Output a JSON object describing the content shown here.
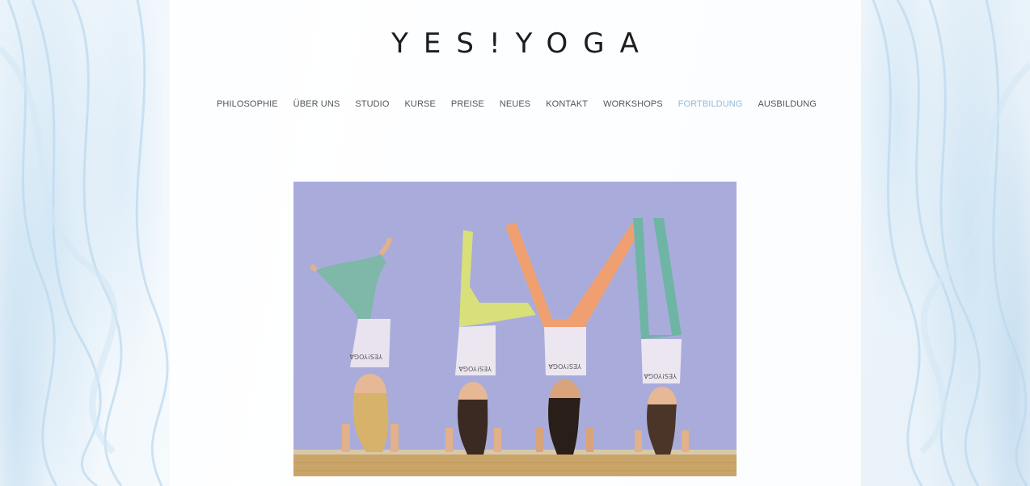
{
  "brand": {
    "logo_text": "YES!YOGA"
  },
  "nav": {
    "items": [
      {
        "label": "PHILOSOPHIE",
        "active": false
      },
      {
        "label": "ÜBER UNS",
        "active": false
      },
      {
        "label": "STUDIO",
        "active": false
      },
      {
        "label": "KURSE",
        "active": false
      },
      {
        "label": "PREISE",
        "active": false
      },
      {
        "label": "NEUES",
        "active": false
      },
      {
        "label": "KONTAKT",
        "active": false
      },
      {
        "label": "WORKSHOPS",
        "active": false
      },
      {
        "label": "FORTBILDUNG",
        "active": true
      },
      {
        "label": "AUSBILDUNG",
        "active": false
      }
    ]
  },
  "hero": {
    "shirt_text": "YES!YOGA"
  },
  "colors": {
    "nav_text": "#555555",
    "nav_active": "#8fbcd9",
    "logo": "#1d1d1d",
    "photo_wall": "#a8abd9",
    "photo_floor": "#c9a56a"
  }
}
